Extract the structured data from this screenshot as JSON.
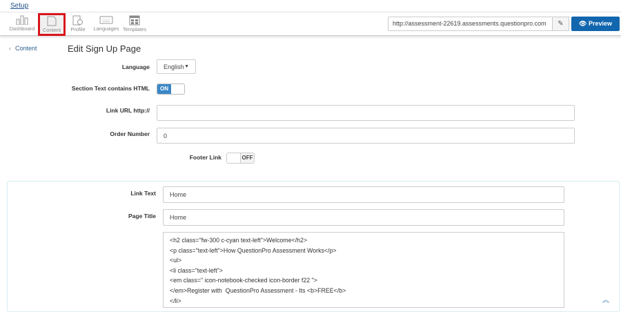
{
  "header": {
    "setup_link": "Setup"
  },
  "toolbar": {
    "items": [
      {
        "label": "Dashboard"
      },
      {
        "label": "Content"
      },
      {
        "label": "Profile"
      },
      {
        "label": "Languages"
      },
      {
        "label": "Templates"
      }
    ],
    "url": "http://assessment-22619.assessments.questionpro.com",
    "preview_label": "Preview"
  },
  "nav": {
    "back_label": "Content"
  },
  "page": {
    "title": "Edit Sign Up Page"
  },
  "form": {
    "language_label": "Language",
    "language_value": "English",
    "html_label": "Section Text contains HTML",
    "html_toggle": "ON",
    "link_url_label": "Link URL http://",
    "link_url_value": "",
    "order_label": "Order Number",
    "order_value": "0",
    "footer_label": "Footer Link",
    "footer_toggle": "OFF"
  },
  "panel": {
    "link_text_label": "Link Text",
    "link_text_value": "Home",
    "page_title_label": "Page Title",
    "page_title_value": "Home",
    "content_lines": [
      "<h2 class=\"fw-300 c-cyan text-left\">Welcome</h2>",
      "<p class=\"text-left\">How QuestionPro Assessment Works</p>",
      "<ul>",
      "<li class=\"text-left\">",
      "<em class=\" icon-notebook-checked icon-border f22 \">",
      "</em>Register with  QuestionPro Assessment - Its <b>FREE</b>",
      "</li>"
    ]
  }
}
